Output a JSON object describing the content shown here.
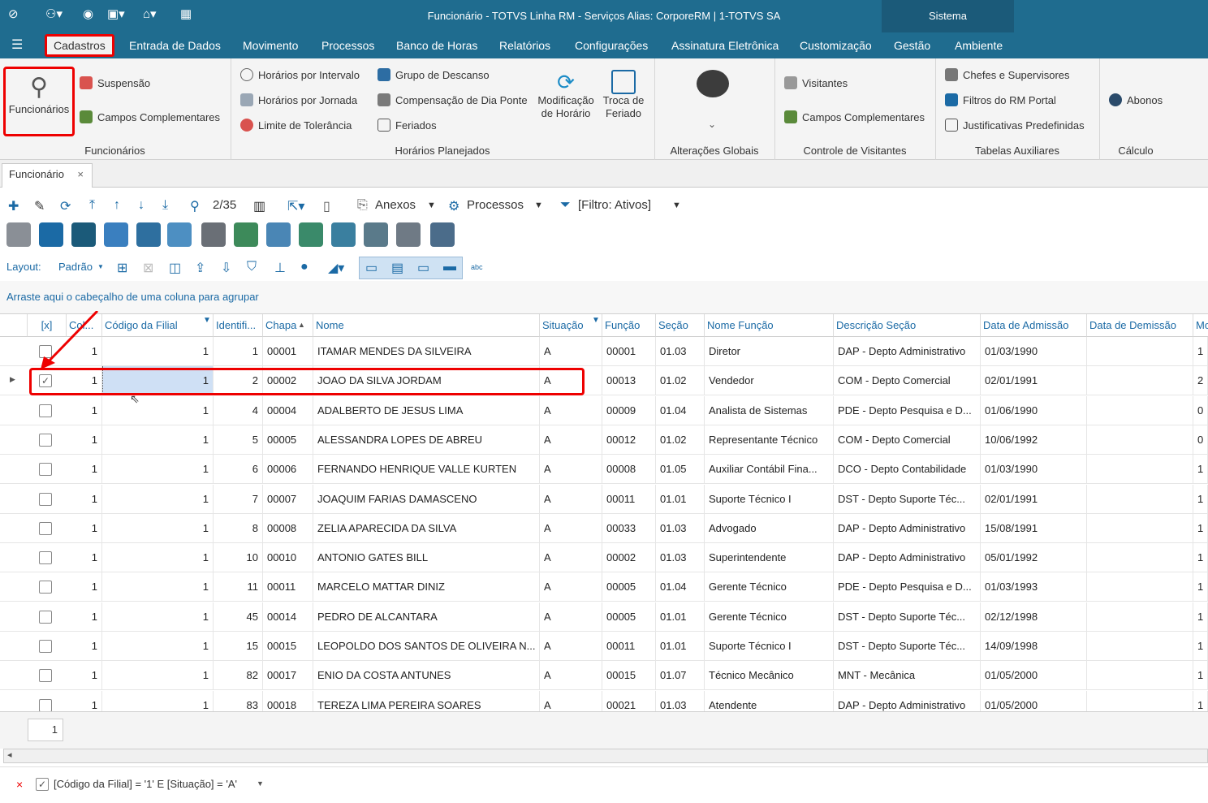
{
  "window": {
    "title": "Funcionário - TOTVS Linha RM - Serviços  Alias: CorporeRM | 1-TOTVS SA",
    "sistema": "Sistema"
  },
  "menu": [
    "Cadastros",
    "Entrada de Dados",
    "Movimento",
    "Processos",
    "Banco de Horas",
    "Relatórios",
    "Configurações",
    "Assinatura Eletrônica",
    "Customização",
    "Gestão",
    "Ambiente"
  ],
  "ribbon": {
    "funcionarios": {
      "big": "Funcionários",
      "suspensao": "Suspensão",
      "campos": "Campos Complementares",
      "group": "Funcionários"
    },
    "horarios": {
      "intervalo": "Horários por Intervalo",
      "jornada": "Horários por Jornada",
      "tolerancia": "Limite de Tolerância",
      "descanso": "Grupo de Descanso",
      "compensacao": "Compensação de Dia Ponte",
      "feriados": "Feriados",
      "modificacao": "Modificação de Horário",
      "troca": "Troca de Feriado",
      "group": "Horários Planejados"
    },
    "alteracoes": {
      "group": "Alterações Globais"
    },
    "visitantes": {
      "visitantes": "Visitantes",
      "campos": "Campos Complementares",
      "group": "Controle de Visitantes"
    },
    "tabelas": {
      "chefes": "Chefes e Supervisores",
      "filtros": "Filtros do RM Portal",
      "justificativas": "Justificativas Predefinidas",
      "group": "Tabelas Auxiliares"
    },
    "calculo": {
      "abonos": "Abonos",
      "group": "Cálculo"
    }
  },
  "doc_tab": {
    "label": "Funcionário",
    "close": "×"
  },
  "toolbar": {
    "pager": "2/35",
    "anexos": "Anexos",
    "processos": "Processos",
    "filtro": "[Filtro: Ativos]"
  },
  "layout_bar": {
    "layout": "Layout:",
    "padrao": "Padrão"
  },
  "group_hint": "Arraste aqui o cabeçalho de uma coluna para agrupar",
  "columns": [
    "[x]",
    "Col...",
    "Código da Filial",
    "Identifi...",
    "Chapa",
    "Nome",
    "Situação",
    "Função",
    "Seção",
    "Nome Função",
    "Descrição Seção",
    "Data de Admissão",
    "Data de Demissão",
    "Mo"
  ],
  "rows": [
    {
      "check": "",
      "col": "1",
      "filial": "1",
      "id": "1",
      "chapa": "00001",
      "nome": "ITAMAR MENDES DA SILVEIRA",
      "sit": "A",
      "funcao": "00001",
      "secao": "01.03",
      "nomefunc": "Diretor",
      "descsecao": "DAP - Depto Administrativo",
      "adm": "01/03/1990",
      "dem": "",
      "mo": "1"
    },
    {
      "check": "✓",
      "col": "1",
      "filial": "1",
      "id": "2",
      "chapa": "00002",
      "nome": "JOAO DA SILVA JORDAM",
      "sit": "A",
      "funcao": "00013",
      "secao": "01.02",
      "nomefunc": "Vendedor",
      "descsecao": "COM - Depto Comercial",
      "adm": "02/01/1991",
      "dem": "",
      "mo": "2"
    },
    {
      "check": "",
      "col": "1",
      "filial": "1",
      "id": "4",
      "chapa": "00004",
      "nome": "ADALBERTO DE JESUS LIMA",
      "sit": "A",
      "funcao": "00009",
      "secao": "01.04",
      "nomefunc": "Analista de Sistemas",
      "descsecao": "PDE - Depto Pesquisa e D...",
      "adm": "01/06/1990",
      "dem": "",
      "mo": "0"
    },
    {
      "check": "",
      "col": "1",
      "filial": "1",
      "id": "5",
      "chapa": "00005",
      "nome": "ALESSANDRA LOPES DE ABREU",
      "sit": "A",
      "funcao": "00012",
      "secao": "01.02",
      "nomefunc": "Representante Técnico",
      "descsecao": "COM - Depto Comercial",
      "adm": "10/06/1992",
      "dem": "",
      "mo": "0"
    },
    {
      "check": "",
      "col": "1",
      "filial": "1",
      "id": "6",
      "chapa": "00006",
      "nome": "FERNANDO HENRIQUE VALLE KURTEN",
      "sit": "A",
      "funcao": "00008",
      "secao": "01.05",
      "nomefunc": "Auxiliar Contábil Fina...",
      "descsecao": "DCO - Depto Contabilidade",
      "adm": "01/03/1990",
      "dem": "",
      "mo": "1"
    },
    {
      "check": "",
      "col": "1",
      "filial": "1",
      "id": "7",
      "chapa": "00007",
      "nome": "JOAQUIM FARIAS DAMASCENO",
      "sit": "A",
      "funcao": "00011",
      "secao": "01.01",
      "nomefunc": "Suporte Técnico I",
      "descsecao": "DST - Depto Suporte Téc...",
      "adm": "02/01/1991",
      "dem": "",
      "mo": "1"
    },
    {
      "check": "",
      "col": "1",
      "filial": "1",
      "id": "8",
      "chapa": "00008",
      "nome": "ZELIA APARECIDA DA SILVA",
      "sit": "A",
      "funcao": "00033",
      "secao": "01.03",
      "nomefunc": "Advogado",
      "descsecao": "DAP - Depto Administrativo",
      "adm": "15/08/1991",
      "dem": "",
      "mo": "1"
    },
    {
      "check": "",
      "col": "1",
      "filial": "1",
      "id": "10",
      "chapa": "00010",
      "nome": "ANTONIO GATES BILL",
      "sit": "A",
      "funcao": "00002",
      "secao": "01.03",
      "nomefunc": "Superintendente",
      "descsecao": "DAP - Depto Administrativo",
      "adm": "05/01/1992",
      "dem": "",
      "mo": "1"
    },
    {
      "check": "",
      "col": "1",
      "filial": "1",
      "id": "11",
      "chapa": "00011",
      "nome": "MARCELO MATTAR DINIZ",
      "sit": "A",
      "funcao": "00005",
      "secao": "01.04",
      "nomefunc": "Gerente Técnico",
      "descsecao": "PDE - Depto Pesquisa e D...",
      "adm": "01/03/1993",
      "dem": "",
      "mo": "1"
    },
    {
      "check": "",
      "col": "1",
      "filial": "1",
      "id": "45",
      "chapa": "00014",
      "nome": "PEDRO DE ALCANTARA",
      "sit": "A",
      "funcao": "00005",
      "secao": "01.01",
      "nomefunc": "Gerente Técnico",
      "descsecao": "DST - Depto Suporte Téc...",
      "adm": "02/12/1998",
      "dem": "",
      "mo": "1"
    },
    {
      "check": "",
      "col": "1",
      "filial": "1",
      "id": "15",
      "chapa": "00015",
      "nome": "LEOPOLDO DOS SANTOS DE OLIVEIRA N...",
      "sit": "A",
      "funcao": "00011",
      "secao": "01.01",
      "nomefunc": "Suporte Técnico I",
      "descsecao": "DST - Depto Suporte Téc...",
      "adm": "14/09/1998",
      "dem": "",
      "mo": "1"
    },
    {
      "check": "",
      "col": "1",
      "filial": "1",
      "id": "82",
      "chapa": "00017",
      "nome": "ENIO DA COSTA ANTUNES",
      "sit": "A",
      "funcao": "00015",
      "secao": "01.07",
      "nomefunc": "Técnico Mecânico",
      "descsecao": "MNT - Mecânica",
      "adm": "01/05/2000",
      "dem": "",
      "mo": "1"
    },
    {
      "check": "",
      "col": "1",
      "filial": "1",
      "id": "83",
      "chapa": "00018",
      "nome": "TEREZA LIMA PEREIRA SOARES",
      "sit": "A",
      "funcao": "00021",
      "secao": "01.03",
      "nomefunc": "Atendente",
      "descsecao": "DAP - Depto Administrativo",
      "adm": "01/05/2000",
      "dem": "",
      "mo": "1"
    }
  ],
  "summary": {
    "count": "1"
  },
  "filter_expr": "[Código da Filial] = '1' E [Situação] = 'A'",
  "colors": {
    "accent": "#1f6c8f",
    "highlight": "#e00000",
    "link": "#1b6aa5"
  }
}
